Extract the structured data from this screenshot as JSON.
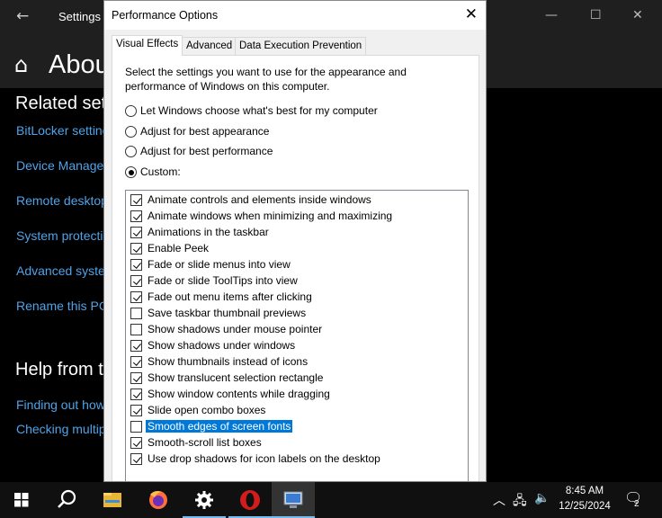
{
  "settings": {
    "title": "Settings",
    "page_title": "About",
    "related_heading": "Related settings",
    "related_links": [
      "BitLocker settings",
      "Device Manager",
      "Remote desktop",
      "System protection",
      "Advanced system settings",
      "Rename this PC"
    ],
    "help_heading": "Help from the web",
    "help_links": [
      "Finding out how many cores my processor has",
      "Checking multiple languages support"
    ]
  },
  "dialog": {
    "title": "Performance Options",
    "tabs": [
      "Visual Effects",
      "Advanced",
      "Data Execution Prevention"
    ],
    "description": "Select the settings you want to use for the appearance and performance of Windows on this computer.",
    "options": [
      {
        "label": "Let Windows choose what's best for my computer",
        "checked": false
      },
      {
        "label": "Adjust for best appearance",
        "checked": false
      },
      {
        "label": "Adjust for best performance",
        "checked": false
      },
      {
        "label": "Custom:",
        "checked": true
      }
    ],
    "effects": [
      {
        "label": "Animate controls and elements inside windows",
        "checked": true
      },
      {
        "label": "Animate windows when minimizing and maximizing",
        "checked": true
      },
      {
        "label": "Animations in the taskbar",
        "checked": true
      },
      {
        "label": "Enable Peek",
        "checked": true
      },
      {
        "label": "Fade or slide menus into view",
        "checked": true
      },
      {
        "label": "Fade or slide ToolTips into view",
        "checked": true
      },
      {
        "label": "Fade out menu items after clicking",
        "checked": true
      },
      {
        "label": "Save taskbar thumbnail previews",
        "checked": false
      },
      {
        "label": "Show shadows under mouse pointer",
        "checked": false
      },
      {
        "label": "Show shadows under windows",
        "checked": true
      },
      {
        "label": "Show thumbnails instead of icons",
        "checked": true
      },
      {
        "label": "Show translucent selection rectangle",
        "checked": true
      },
      {
        "label": "Show window contents while dragging",
        "checked": true
      },
      {
        "label": "Slide open combo boxes",
        "checked": true
      },
      {
        "label": "Smooth edges of screen fonts",
        "checked": false,
        "selected": true
      },
      {
        "label": "Smooth-scroll list boxes",
        "checked": true
      },
      {
        "label": "Use drop shadows for icon labels on the desktop",
        "checked": true
      }
    ]
  },
  "taskbar": {
    "time": "8:45 AM",
    "date": "12/25/2024",
    "notification_count": "2",
    "icons": [
      "start-icon",
      "search-icon",
      "file-explorer-icon",
      "firefox-icon",
      "settings-icon",
      "opera-icon",
      "system-properties-icon"
    ]
  },
  "colors": {
    "accent": "#0078d7",
    "link": "#4fa3e8",
    "taskbar": "#101010"
  }
}
